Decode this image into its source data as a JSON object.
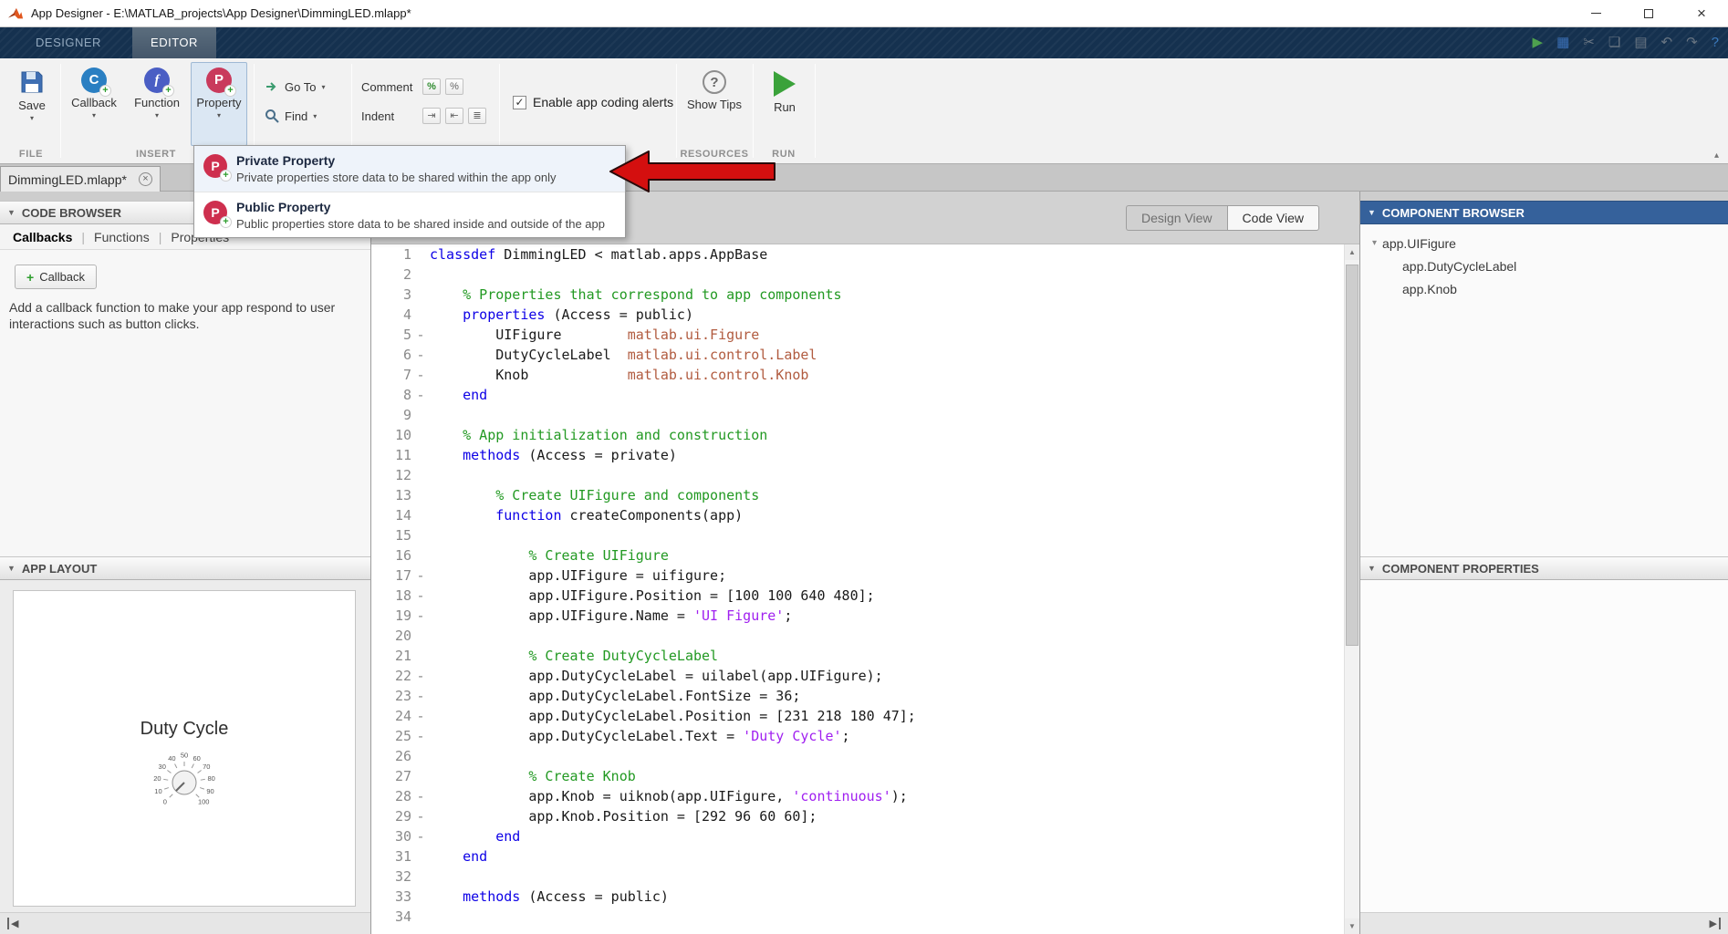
{
  "window": {
    "title": "App Designer - E:\\MATLAB_projects\\App Designer\\DimmingLED.mlapp*"
  },
  "icons": {
    "plus": "+",
    "caret_down": "▾",
    "panel_caret": "▼",
    "tree_caret": "▾",
    "scroll_up": "▲",
    "scroll_down": "▼",
    "collapse_left": "◀",
    "expand_right": "▶",
    "ribbon_collapse": "▴",
    "check": "✓",
    "close": "×",
    "tab_close": "×",
    "tab_sep": "|",
    "help": "?"
  },
  "colors": {
    "component_browser_header": "#35619b",
    "menu_icon": "#ce2f4e",
    "arrow_red": "#d40f0f",
    "run_green": "#3aa23a"
  },
  "ribbon": {
    "tabs": [
      {
        "label": "DESIGNER"
      },
      {
        "label": "EDITOR"
      }
    ],
    "quick_access": [
      {
        "name": "run",
        "glyph": "▶",
        "color": "#4ea04e",
        "enabled": true
      },
      {
        "name": "save",
        "glyph": "▦",
        "color": "#3a6fb5",
        "enabled": true
      },
      {
        "name": "cut",
        "glyph": "✂",
        "color": "#ababab",
        "enabled": false
      },
      {
        "name": "copy",
        "glyph": "❏",
        "color": "#ababab",
        "enabled": false
      },
      {
        "name": "paste",
        "glyph": "▤",
        "color": "#ababab",
        "enabled": false
      },
      {
        "name": "undo",
        "glyph": "↶",
        "color": "#ababab",
        "enabled": false
      },
      {
        "name": "redo",
        "glyph": "↷",
        "color": "#ababab",
        "enabled": false
      },
      {
        "name": "help",
        "glyph": "?",
        "color": "#3a7abf",
        "enabled": true
      }
    ]
  },
  "toolbar": {
    "save_label": "Save",
    "insert_buttons": [
      {
        "label": "Callback",
        "letter": "C",
        "color": "#2a7fc2"
      },
      {
        "label": "Function",
        "letter": "f",
        "color": "#4a5ec4"
      },
      {
        "label": "Property",
        "letter": "P",
        "color": "#c93a5c"
      }
    ],
    "goto_label": "Go To",
    "find_label": "Find",
    "comment_label": "Comment",
    "indent_label": "Indent",
    "comment_icons": [
      "%",
      "%"
    ],
    "indent_icons": [
      "⇥",
      "⇤",
      "≣"
    ],
    "alerts_label": "Enable app coding alerts",
    "alerts_checked": true,
    "show_tips_label": "Show Tips",
    "run_label": "Run",
    "sections": [
      "FILE",
      "INSERT",
      "RESOURCES",
      "RUN"
    ]
  },
  "property_menu": {
    "icon_letter": "P",
    "items": [
      {
        "title": "Private Property",
        "desc": "Private properties store data to be shared within the app only"
      },
      {
        "title": "Public Property",
        "desc": "Public properties store data to be shared inside and outside of the app"
      }
    ]
  },
  "doc_tab": {
    "label": "DimmingLED.mlapp*"
  },
  "code_browser": {
    "title": "CODE BROWSER",
    "tabs": [
      {
        "label": "Callbacks",
        "active": true
      },
      {
        "label": "Functions",
        "active": false
      },
      {
        "label": "Properties",
        "active": false
      }
    ],
    "add_button_label": "Callback",
    "hint": "Add a callback function to make your app respond to user interactions such as button clicks."
  },
  "app_layout": {
    "title": "APP LAYOUT",
    "preview_label": "Duty Cycle",
    "knob_labels": [
      "0",
      "10",
      "20",
      "30",
      "40",
      "50",
      "60",
      "70",
      "80",
      "90",
      "100"
    ]
  },
  "view_toggle": {
    "design": "Design View",
    "code": "Code View"
  },
  "component_browser": {
    "title": "COMPONENT BROWSER",
    "tree": [
      {
        "label": "app.UIFigure",
        "level": 0
      },
      {
        "label": "app.DutyCycleLabel",
        "level": 1
      },
      {
        "label": "app.Knob",
        "level": 1
      }
    ]
  },
  "component_properties": {
    "title": "COMPONENT PROPERTIES"
  },
  "editor": {
    "lines": [
      {
        "n": "1",
        "d": 0,
        "s": [
          [
            "k",
            "classdef"
          ],
          [
            "p",
            " DimmingLED < matlab.apps.AppBase"
          ]
        ]
      },
      {
        "n": "2",
        "d": 0,
        "s": []
      },
      {
        "n": "3",
        "d": 0,
        "s": [
          [
            "c",
            "    % Properties that correspond to app components"
          ]
        ]
      },
      {
        "n": "4",
        "d": 0,
        "s": [
          [
            "p",
            "    "
          ],
          [
            "k",
            "properties"
          ],
          [
            "p",
            " (Access = public)"
          ]
        ]
      },
      {
        "n": "5",
        "d": 1,
        "s": [
          [
            "p",
            "        UIFigure        "
          ],
          [
            "t",
            "matlab.ui.Figure"
          ]
        ]
      },
      {
        "n": "6",
        "d": 1,
        "s": [
          [
            "p",
            "        DutyCycleLabel  "
          ],
          [
            "t",
            "matlab.ui.control.Label"
          ]
        ]
      },
      {
        "n": "7",
        "d": 1,
        "s": [
          [
            "p",
            "        Knob            "
          ],
          [
            "t",
            "matlab.ui.control.Knob"
          ]
        ]
      },
      {
        "n": "8",
        "d": 1,
        "s": [
          [
            "p",
            "    "
          ],
          [
            "k",
            "end"
          ]
        ]
      },
      {
        "n": "9",
        "d": 0,
        "s": []
      },
      {
        "n": "10",
        "d": 0,
        "s": [
          [
            "c",
            "    % App initialization and construction"
          ]
        ]
      },
      {
        "n": "11",
        "d": 0,
        "s": [
          [
            "p",
            "    "
          ],
          [
            "k",
            "methods"
          ],
          [
            "p",
            " (Access = private)"
          ]
        ]
      },
      {
        "n": "12",
        "d": 0,
        "s": []
      },
      {
        "n": "13",
        "d": 0,
        "s": [
          [
            "c",
            "        % Create UIFigure and components"
          ]
        ]
      },
      {
        "n": "14",
        "d": 0,
        "s": [
          [
            "p",
            "        "
          ],
          [
            "k",
            "function"
          ],
          [
            "p",
            " createComponents(app)"
          ]
        ]
      },
      {
        "n": "15",
        "d": 0,
        "s": []
      },
      {
        "n": "16",
        "d": 0,
        "s": [
          [
            "c",
            "            % Create UIFigure"
          ]
        ]
      },
      {
        "n": "17",
        "d": 1,
        "s": [
          [
            "p",
            "            app.UIFigure = uifigure;"
          ]
        ]
      },
      {
        "n": "18",
        "d": 1,
        "s": [
          [
            "p",
            "            app.UIFigure.Position = [100 100 640 480];"
          ]
        ]
      },
      {
        "n": "19",
        "d": 1,
        "s": [
          [
            "p",
            "            app.UIFigure.Name = "
          ],
          [
            "s2",
            "'UI Figure'"
          ],
          [
            "p",
            ";"
          ]
        ]
      },
      {
        "n": "20",
        "d": 0,
        "s": []
      },
      {
        "n": "21",
        "d": 0,
        "s": [
          [
            "c",
            "            % Create DutyCycleLabel"
          ]
        ]
      },
      {
        "n": "22",
        "d": 1,
        "s": [
          [
            "p",
            "            app.DutyCycleLabel = uilabel(app.UIFigure);"
          ]
        ]
      },
      {
        "n": "23",
        "d": 1,
        "s": [
          [
            "p",
            "            app.DutyCycleLabel.FontSize = 36;"
          ]
        ]
      },
      {
        "n": "24",
        "d": 1,
        "s": [
          [
            "p",
            "            app.DutyCycleLabel.Position = [231 218 180 47];"
          ]
        ]
      },
      {
        "n": "25",
        "d": 1,
        "s": [
          [
            "p",
            "            app.DutyCycleLabel.Text = "
          ],
          [
            "s2",
            "'Duty Cycle'"
          ],
          [
            "p",
            ";"
          ]
        ]
      },
      {
        "n": "26",
        "d": 0,
        "s": []
      },
      {
        "n": "27",
        "d": 0,
        "s": [
          [
            "c",
            "            % Create Knob"
          ]
        ]
      },
      {
        "n": "28",
        "d": 1,
        "s": [
          [
            "p",
            "            app.Knob = uiknob(app.UIFigure, "
          ],
          [
            "s2",
            "'continuous'"
          ],
          [
            "p",
            ");"
          ]
        ]
      },
      {
        "n": "29",
        "d": 1,
        "s": [
          [
            "p",
            "            app.Knob.Position = [292 96 60 60];"
          ]
        ]
      },
      {
        "n": "30",
        "d": 1,
        "s": [
          [
            "p",
            "        "
          ],
          [
            "k",
            "end"
          ]
        ]
      },
      {
        "n": "31",
        "d": 0,
        "s": [
          [
            "p",
            "    "
          ],
          [
            "k",
            "end"
          ]
        ]
      },
      {
        "n": "32",
        "d": 0,
        "s": []
      },
      {
        "n": "33",
        "d": 0,
        "s": [
          [
            "p",
            "    "
          ],
          [
            "k",
            "methods"
          ],
          [
            "p",
            " (Access = public)"
          ]
        ]
      },
      {
        "n": "34",
        "d": 0,
        "s": []
      }
    ]
  }
}
